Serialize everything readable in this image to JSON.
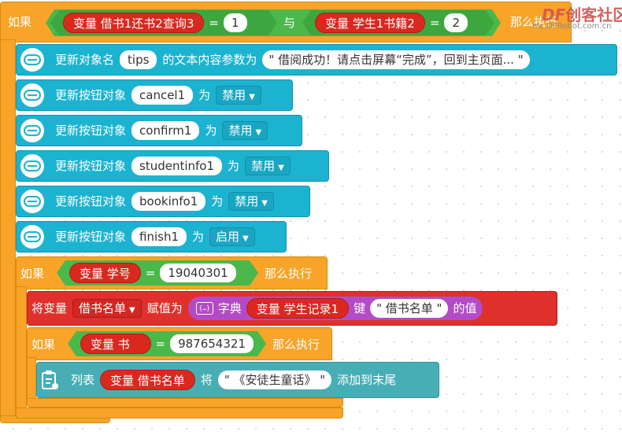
{
  "keywords": {
    "if": "如果",
    "then_do": "那么执行",
    "and": "与",
    "eq": "="
  },
  "outer_if": {
    "left_var": "变量 借书1还书2查询3",
    "left_value": "1",
    "right_var": "变量 学生1书籍2",
    "right_value": "2",
    "then_label": "那么执行"
  },
  "set_text_block": {
    "label": "更新对象名",
    "target": "tips",
    "mid": "的文本内容参数为",
    "value": "\" 借阅成功！请点击屏幕“完成”，回到主页面... \""
  },
  "button_blocks": [
    {
      "label": "更新按钮对象",
      "target": "cancel1",
      "as": "为",
      "state": "禁用"
    },
    {
      "label": "更新按钮对象",
      "target": "confirm1",
      "as": "为",
      "state": "禁用"
    },
    {
      "label": "更新按钮对象",
      "target": "studentinfo1",
      "as": "为",
      "state": "禁用"
    },
    {
      "label": "更新按钮对象",
      "target": "bookinfo1",
      "as": "为",
      "state": "禁用"
    },
    {
      "label": "更新按钮对象",
      "target": "finish1",
      "as": "为",
      "state": "启用"
    }
  ],
  "inner_if_1": {
    "var": "变量 学号",
    "value": "19040301",
    "then_label": "那么执行"
  },
  "assign_block": {
    "label": "将变量",
    "var_name": "借书名单",
    "assign": "赋值为",
    "dict_icon": "{…}",
    "dict_label": "字典",
    "dict_var": "变量 学生记录1",
    "key_label": "键",
    "key_value": "\" 借书名单 \"",
    "value_of": "的值"
  },
  "inner_if_2": {
    "var": "变量 书号",
    "value": "987654321",
    "then_label": "那么执行"
  },
  "list_block": {
    "label": "列表",
    "var": "变量 借书名单",
    "will": "将",
    "item": "\" 《安徒生童话》 \"",
    "append": "添加到末尾"
  },
  "watermark": {
    "brand": "创客社区",
    "prefix": "DF",
    "url": "mc.DFRobot.com.cn"
  },
  "colors": {
    "control": "#f7a428",
    "object": "#1cb3d1",
    "variable": "#e0302c",
    "logic": "#4ab84a",
    "dict": "#b44bc6",
    "list": "#48aeb5"
  }
}
